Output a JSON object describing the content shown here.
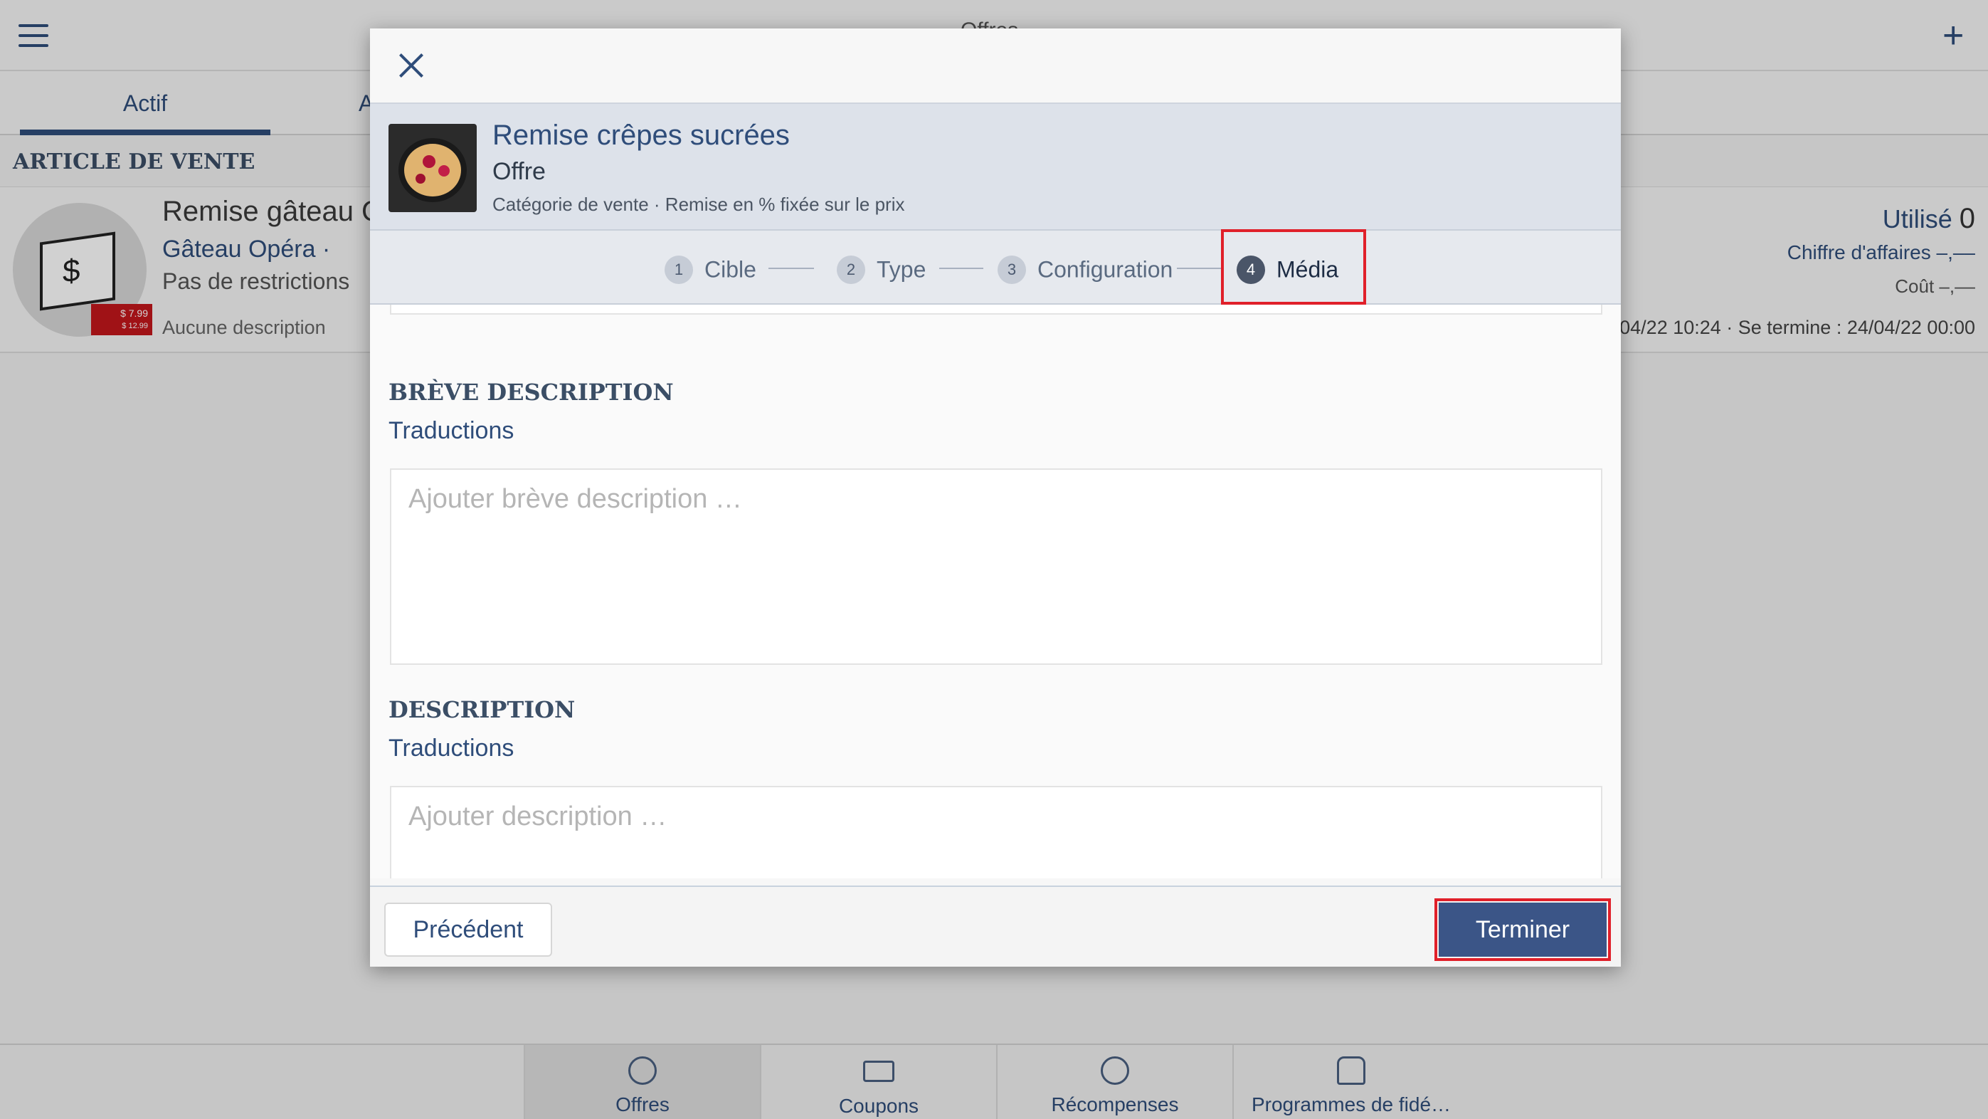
{
  "app": {
    "title": "Offres",
    "tabs": [
      {
        "label": "Actif"
      },
      {
        "label": "A"
      }
    ],
    "section_title": "ARTICLE DE VENTE"
  },
  "card": {
    "title": "Remise gâteau O",
    "product": "Gâteau Opéra ·",
    "restrictions": "Pas de restrictions",
    "description": "Aucune description",
    "price_tag_1": "$ 7.99",
    "price_tag_2": "$ 12.99",
    "used_label": "Utilisé",
    "used_value": "0",
    "revenue": "Chiffre d'affaires –,––",
    "cost": "Coût –,––",
    "dates": "04/22 10:24 · Se termine : 24/04/22 00:00"
  },
  "bottom_nav": {
    "items": [
      {
        "label": "Offres",
        "icon": "percent-badge-icon"
      },
      {
        "label": "Coupons",
        "icon": "coupon-icon"
      },
      {
        "label": "Récompenses",
        "icon": "award-icon"
      },
      {
        "label": "Programmes de fidé…",
        "icon": "loyalty-person-icon"
      }
    ]
  },
  "modal": {
    "offer_title": "Remise crêpes sucrées",
    "offer_kind": "Offre",
    "offer_category": "Catégorie de vente · Remise en % fixée sur le prix",
    "steps": [
      {
        "num": "1",
        "label": "Cible"
      },
      {
        "num": "2",
        "label": "Type"
      },
      {
        "num": "3",
        "label": "Configuration"
      },
      {
        "num": "4",
        "label": "Média"
      }
    ],
    "short_desc": {
      "title": "BRÈVE DESCRIPTION",
      "translations": "Traductions",
      "placeholder": "Ajouter brève description …"
    },
    "desc": {
      "title": "DESCRIPTION",
      "translations": "Traductions",
      "placeholder": "Ajouter description …"
    },
    "prev_label": "Précédent",
    "finish_label": "Terminer"
  },
  "colors": {
    "accent": "#2f4d7a",
    "primary_button": "#3b5587",
    "highlight": "#e0202a"
  }
}
